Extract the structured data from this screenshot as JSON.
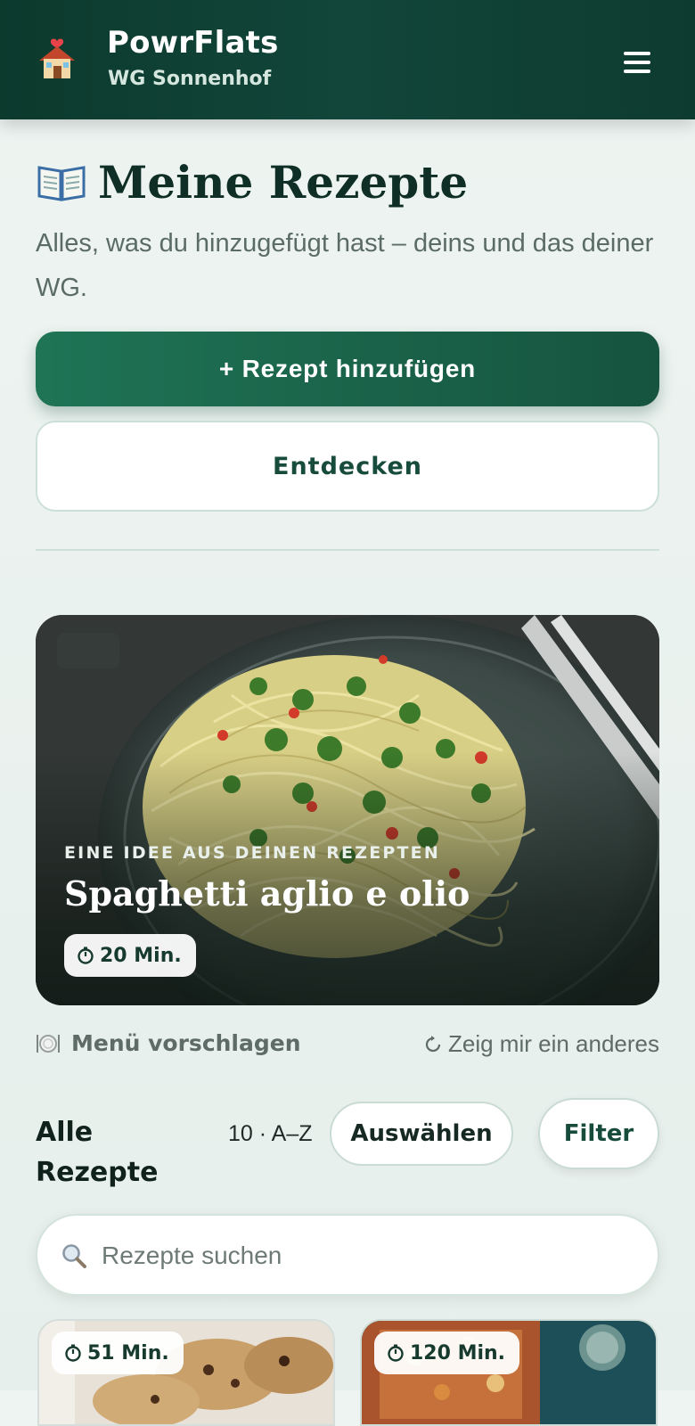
{
  "header": {
    "app_name": "PowrFlats",
    "wg_name": "WG Sonnenhof",
    "logo_icon": "house-with-heart-icon",
    "menu_icon": "hamburger-menu-icon"
  },
  "page": {
    "title": "Meine Rezepte",
    "title_icon": "open-book-icon",
    "subtitle": "Alles, was du hinzugefügt hast – deins und das deiner WG."
  },
  "actions": {
    "add_recipe": "+ Rezept hinzufügen",
    "discover": "Entdecken"
  },
  "featured": {
    "kicker": "EINE IDEE AUS DEINEN REZEPTEN",
    "title": "Spaghetti aglio e olio",
    "time": "20 Min."
  },
  "suggest": {
    "menu_label": "Menü vorschlagen",
    "menu_icon": "plate-cutlery-icon",
    "shuffle_label": "Zeig mir ein anderes",
    "shuffle_icon": "refresh-icon"
  },
  "list": {
    "title": "Alle Rezepte",
    "count_sort": "10 · A–Z",
    "select_label": "Auswählen",
    "filter_label": "Filter",
    "search_placeholder": "Rezepte suchen"
  },
  "recipes": [
    {
      "time": "51 Min."
    },
    {
      "time": "120 Min."
    }
  ],
  "colors": {
    "header_bg": "#0e3e31",
    "primary": "#1b6a4f",
    "accent_text": "#174b3b"
  }
}
